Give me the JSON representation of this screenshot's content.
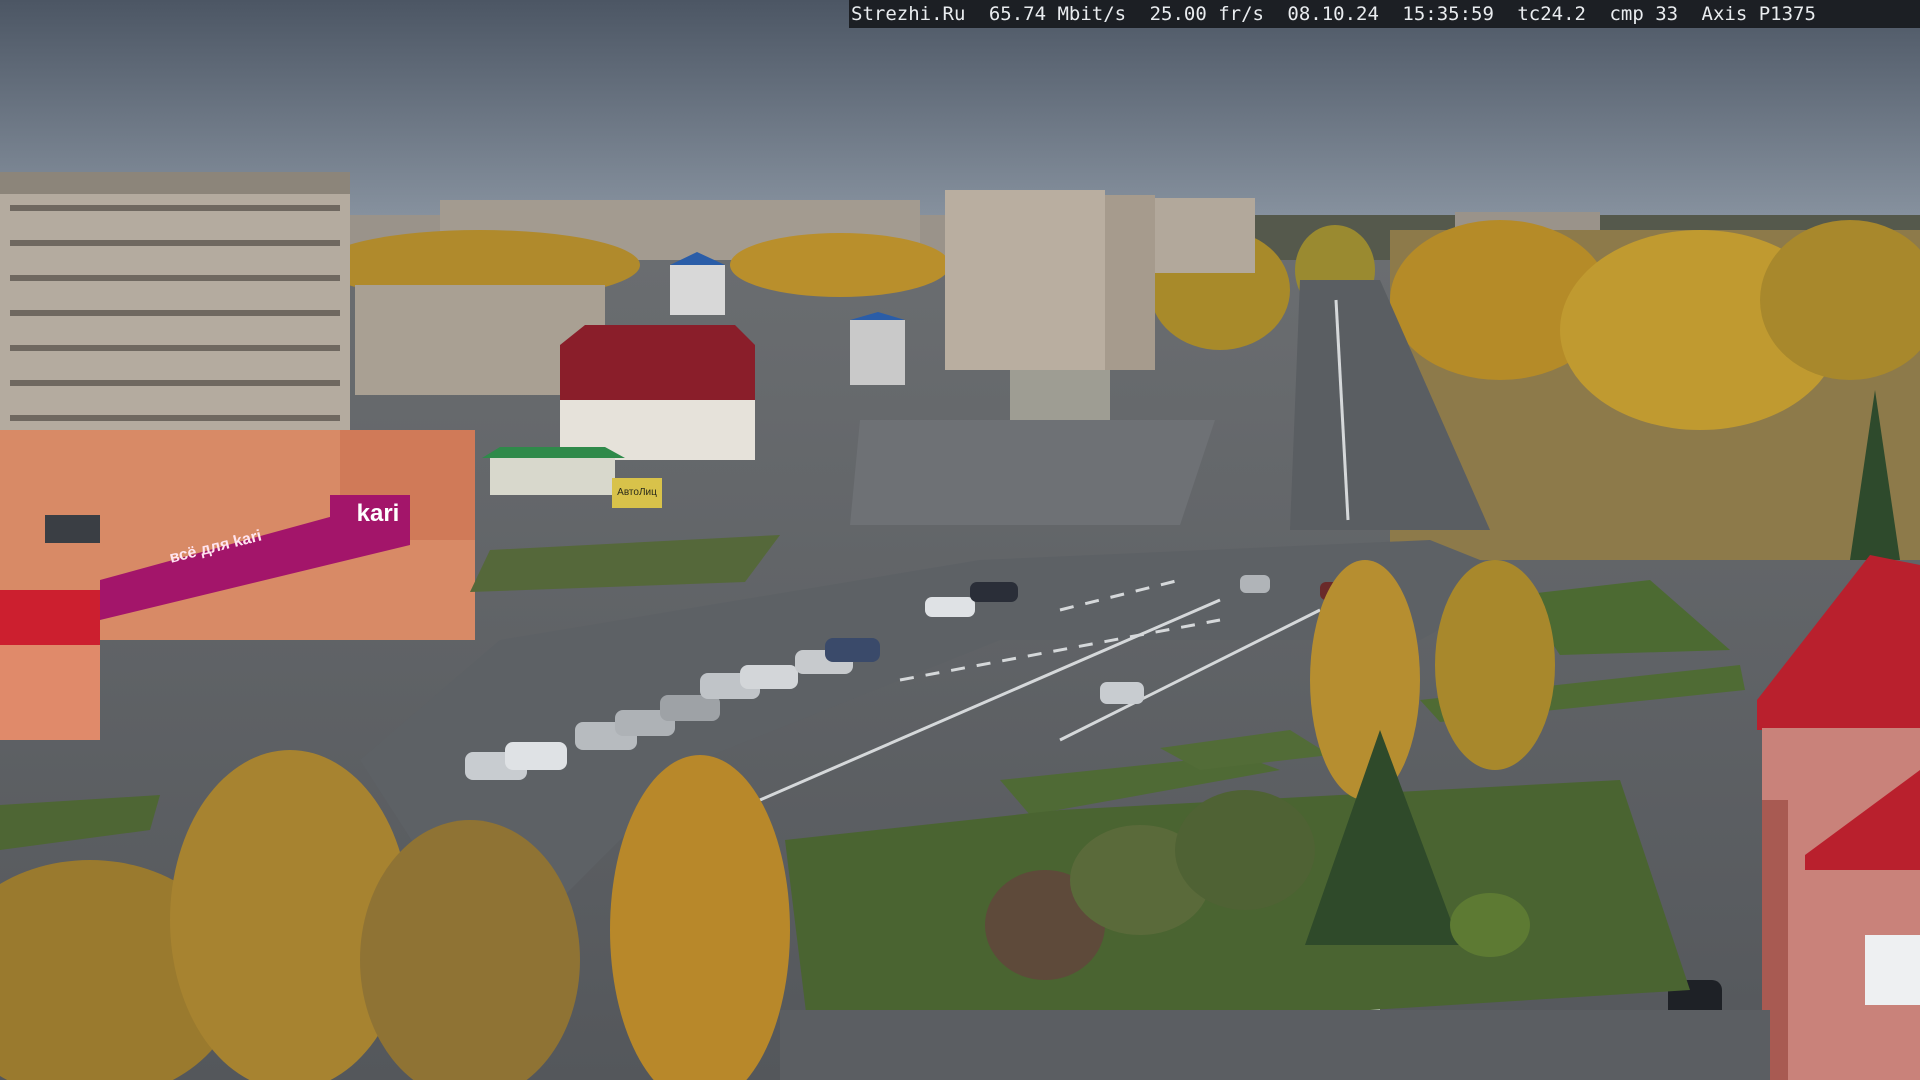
{
  "overlay": {
    "site": "Strezhi.Ru",
    "bitrate": "65.74 Mbit/s",
    "framerate": "25.00 fr/s",
    "date": "08.10.24",
    "time": "15:35:59",
    "temp": "tc24.2",
    "cmp": "cmp 33",
    "camera": "Axis P1375"
  },
  "signs": {
    "store_main": "kari",
    "store_banner": "всё для kari",
    "shop_sign": "АвтоЛиц"
  },
  "colors": {
    "sky_top": "#4c5664",
    "sky_bottom": "#8a95a2",
    "road": "#5d6165",
    "plaza": "#6b6e72",
    "grass": "#4f6a35",
    "foliage_gold": "#b98a2a",
    "storefront_magenta": "#a3156a",
    "roof_red": "#a3202b"
  }
}
